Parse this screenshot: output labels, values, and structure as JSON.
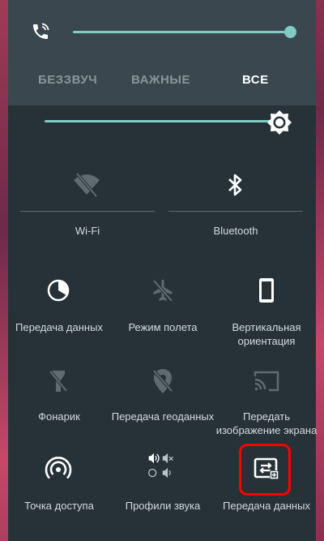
{
  "sound_modes": {
    "silent": "БЕЗЗВУЧ",
    "important": "ВАЖНЫЕ",
    "all": "ВСЕ"
  },
  "tiles": {
    "wifi": "Wi-Fi",
    "bluetooth": "Bluetooth",
    "data": "Передача данных",
    "airplane": "Режим полета",
    "rotation_line1": "Вертикальная",
    "rotation_line2": "ориентация",
    "flashlight": "Фонарик",
    "location": "Передача геоданных",
    "cast_line1": "Передать",
    "cast_line2": "изображение экрана",
    "hotspot": "Точка доступа",
    "sound_profiles": "Профили звука",
    "data_transfer": "Передача данных"
  },
  "colors": {
    "accent": "#80cbc4",
    "panel": "#263238",
    "header": "#3a474e",
    "highlight": "#ff0000"
  },
  "sliders": {
    "volume": 1.0,
    "brightness": 1.0
  }
}
